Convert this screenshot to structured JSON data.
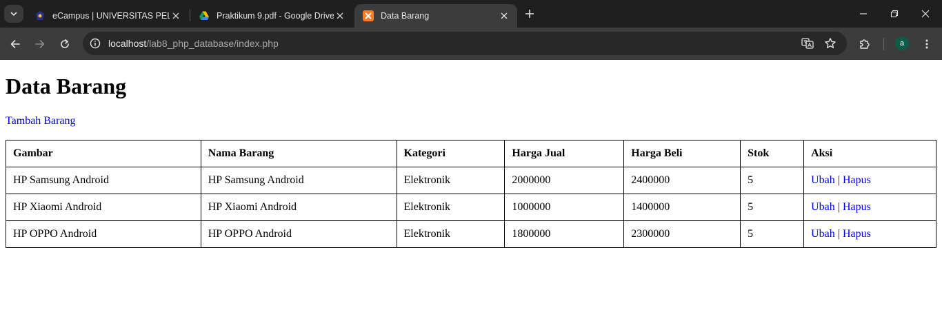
{
  "browser": {
    "tabs": [
      {
        "title": "eCampus | UNIVERSITAS PELITA",
        "active": false
      },
      {
        "title": "Praktikum 9.pdf - Google Drive",
        "active": false
      },
      {
        "title": "Data Barang",
        "active": true
      }
    ],
    "url_host": "localhost",
    "url_path": "/lab8_php_database/index.php",
    "profile_initial": "a"
  },
  "page": {
    "heading": "Data Barang",
    "add_link": "Tambah Barang",
    "table": {
      "headers": [
        "Gambar",
        "Nama Barang",
        "Kategori",
        "Harga Jual",
        "Harga Beli",
        "Stok",
        "Aksi"
      ],
      "rows": [
        {
          "gambar": "HP Samsung Android",
          "nama": "HP Samsung Android",
          "kategori": "Elektronik",
          "harga_jual": "2000000",
          "harga_beli": "2400000",
          "stok": "5",
          "edit": "Ubah",
          "sep": "|",
          "delete": "Hapus"
        },
        {
          "gambar": "HP Xiaomi Android",
          "nama": "HP Xiaomi Android",
          "kategori": "Elektronik",
          "harga_jual": "1000000",
          "harga_beli": "1400000",
          "stok": "5",
          "edit": "Ubah",
          "sep": "|",
          "delete": "Hapus"
        },
        {
          "gambar": "HP OPPO Android",
          "nama": "HP OPPO Android",
          "kategori": "Elektronik",
          "harga_jual": "1800000",
          "harga_beli": "2300000",
          "stok": "5",
          "edit": "Ubah",
          "sep": "|",
          "delete": "Hapus"
        }
      ]
    }
  },
  "colors": {
    "tabbar_bg": "#1f1f1f",
    "toolbar_bg": "#3c3c3c",
    "link": "#0000ee"
  }
}
